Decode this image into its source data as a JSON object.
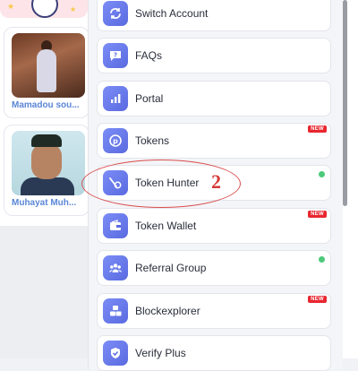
{
  "background": {
    "profiles": [
      {
        "name": "Mamadou sou..."
      },
      {
        "name": "Muhayat Muh..."
      }
    ]
  },
  "menu": {
    "items": [
      {
        "label": "Switch Account",
        "icon": "switch-icon",
        "badge": "",
        "dot": false
      },
      {
        "label": "FAQs",
        "icon": "faq-chat-icon",
        "badge": "",
        "dot": false
      },
      {
        "label": "Portal",
        "icon": "portal-chart-icon",
        "badge": "",
        "dot": false
      },
      {
        "label": "Tokens",
        "icon": "token-coin-icon",
        "badge": "NEW",
        "dot": false
      },
      {
        "label": "Token Hunter",
        "icon": "token-hunter-icon",
        "badge": "",
        "dot": true
      },
      {
        "label": "Token Wallet",
        "icon": "wallet-icon",
        "badge": "NEW",
        "dot": false
      },
      {
        "label": "Referral Group",
        "icon": "group-icon",
        "badge": "",
        "dot": true
      },
      {
        "label": "Blockexplorer",
        "icon": "blocks-icon",
        "badge": "NEW",
        "dot": false
      },
      {
        "label": "Verify Plus",
        "icon": "verify-icon",
        "badge": "",
        "dot": false
      }
    ]
  },
  "annotation": {
    "number": "2"
  },
  "colors": {
    "accent": "#6a7cf0",
    "badge": "#e8262f",
    "online_dot": "#4cc97a",
    "annotation": "#d63a3a",
    "profile_name": "#5a86d6"
  }
}
